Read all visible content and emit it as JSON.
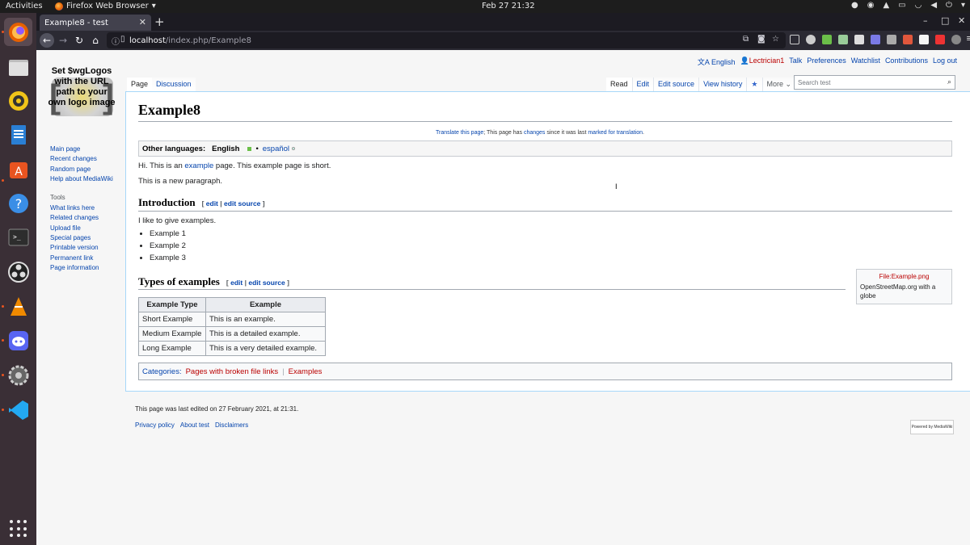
{
  "topbar": {
    "activities": "Activities",
    "app_name": "Firefox Web Browser",
    "clock": "Feb 27  21:32"
  },
  "browser": {
    "tab_title": "Example8 - test",
    "url_host": "localhost",
    "url_path": "/index.php/Example8"
  },
  "wiki": {
    "logo_text": "Set $wgLogos with the URL path to your own logo image",
    "personal": {
      "language": "English",
      "user": "Lectrician1",
      "talk": "Talk",
      "preferences": "Preferences",
      "watchlist": "Watchlist",
      "contributions": "Contributions",
      "logout": "Log out"
    },
    "tabs_left": {
      "page": "Page",
      "discussion": "Discussion"
    },
    "tabs_right": {
      "read": "Read",
      "edit": "Edit",
      "edit_source": "Edit source",
      "view_history": "View history",
      "more": "More"
    },
    "search_placeholder": "Search test",
    "sidebar": {
      "navigation": [
        "Main page",
        "Recent changes",
        "Random page",
        "Help about MediaWiki"
      ],
      "tools_heading": "Tools",
      "tools": [
        "What links here",
        "Related changes",
        "Upload file",
        "Special pages",
        "Printable version",
        "Permanent link",
        "Page information"
      ]
    },
    "title": "Example8",
    "translate_note": {
      "link1": "Translate this page",
      "text1": "; This page has ",
      "link2": "changes",
      "text2": " since it was last ",
      "link3": "marked for translation",
      "text3": "."
    },
    "languages": {
      "label": "Other languages:",
      "current": "English",
      "sep": "•",
      "other": "español"
    },
    "para1": {
      "before": "Hi. This is an ",
      "link": "example",
      "after": " page. This example page is short."
    },
    "para2": "This is a new paragraph.",
    "section1": {
      "title": "Introduction",
      "bracket_open": "[",
      "edit": "edit",
      "pipe": "|",
      "edit_source": "edit source",
      "bracket_close": "]"
    },
    "section1_text": "I like to give examples.",
    "bullets": [
      "Example 1",
      "Example 2",
      "Example 3"
    ],
    "section2": {
      "title": "Types of examples",
      "bracket_open": "[",
      "edit": "edit",
      "pipe": "|",
      "edit_source": "edit source",
      "bracket_close": "]"
    },
    "table": {
      "headers": [
        "Example Type",
        "Example"
      ],
      "rows": [
        [
          "Short Example",
          "This is an example."
        ],
        [
          "Medium Example",
          "This is a detailed example."
        ],
        [
          "Long Example",
          "This is a very detailed example."
        ]
      ]
    },
    "thumb": {
      "link": "File:Example.png",
      "caption": "OpenStreetMap.org with a globe"
    },
    "categories": {
      "label": "Categories",
      "colon": ":",
      "items": [
        "Pages with broken file links",
        "Examples"
      ],
      "sep": "|"
    },
    "footer": {
      "last_edited": "This page was last edited on 27 February 2021, at 21:31.",
      "links": [
        "Privacy policy",
        "About test",
        "Disclaimers"
      ],
      "powered_by": "Powered by MediaWiki"
    }
  }
}
